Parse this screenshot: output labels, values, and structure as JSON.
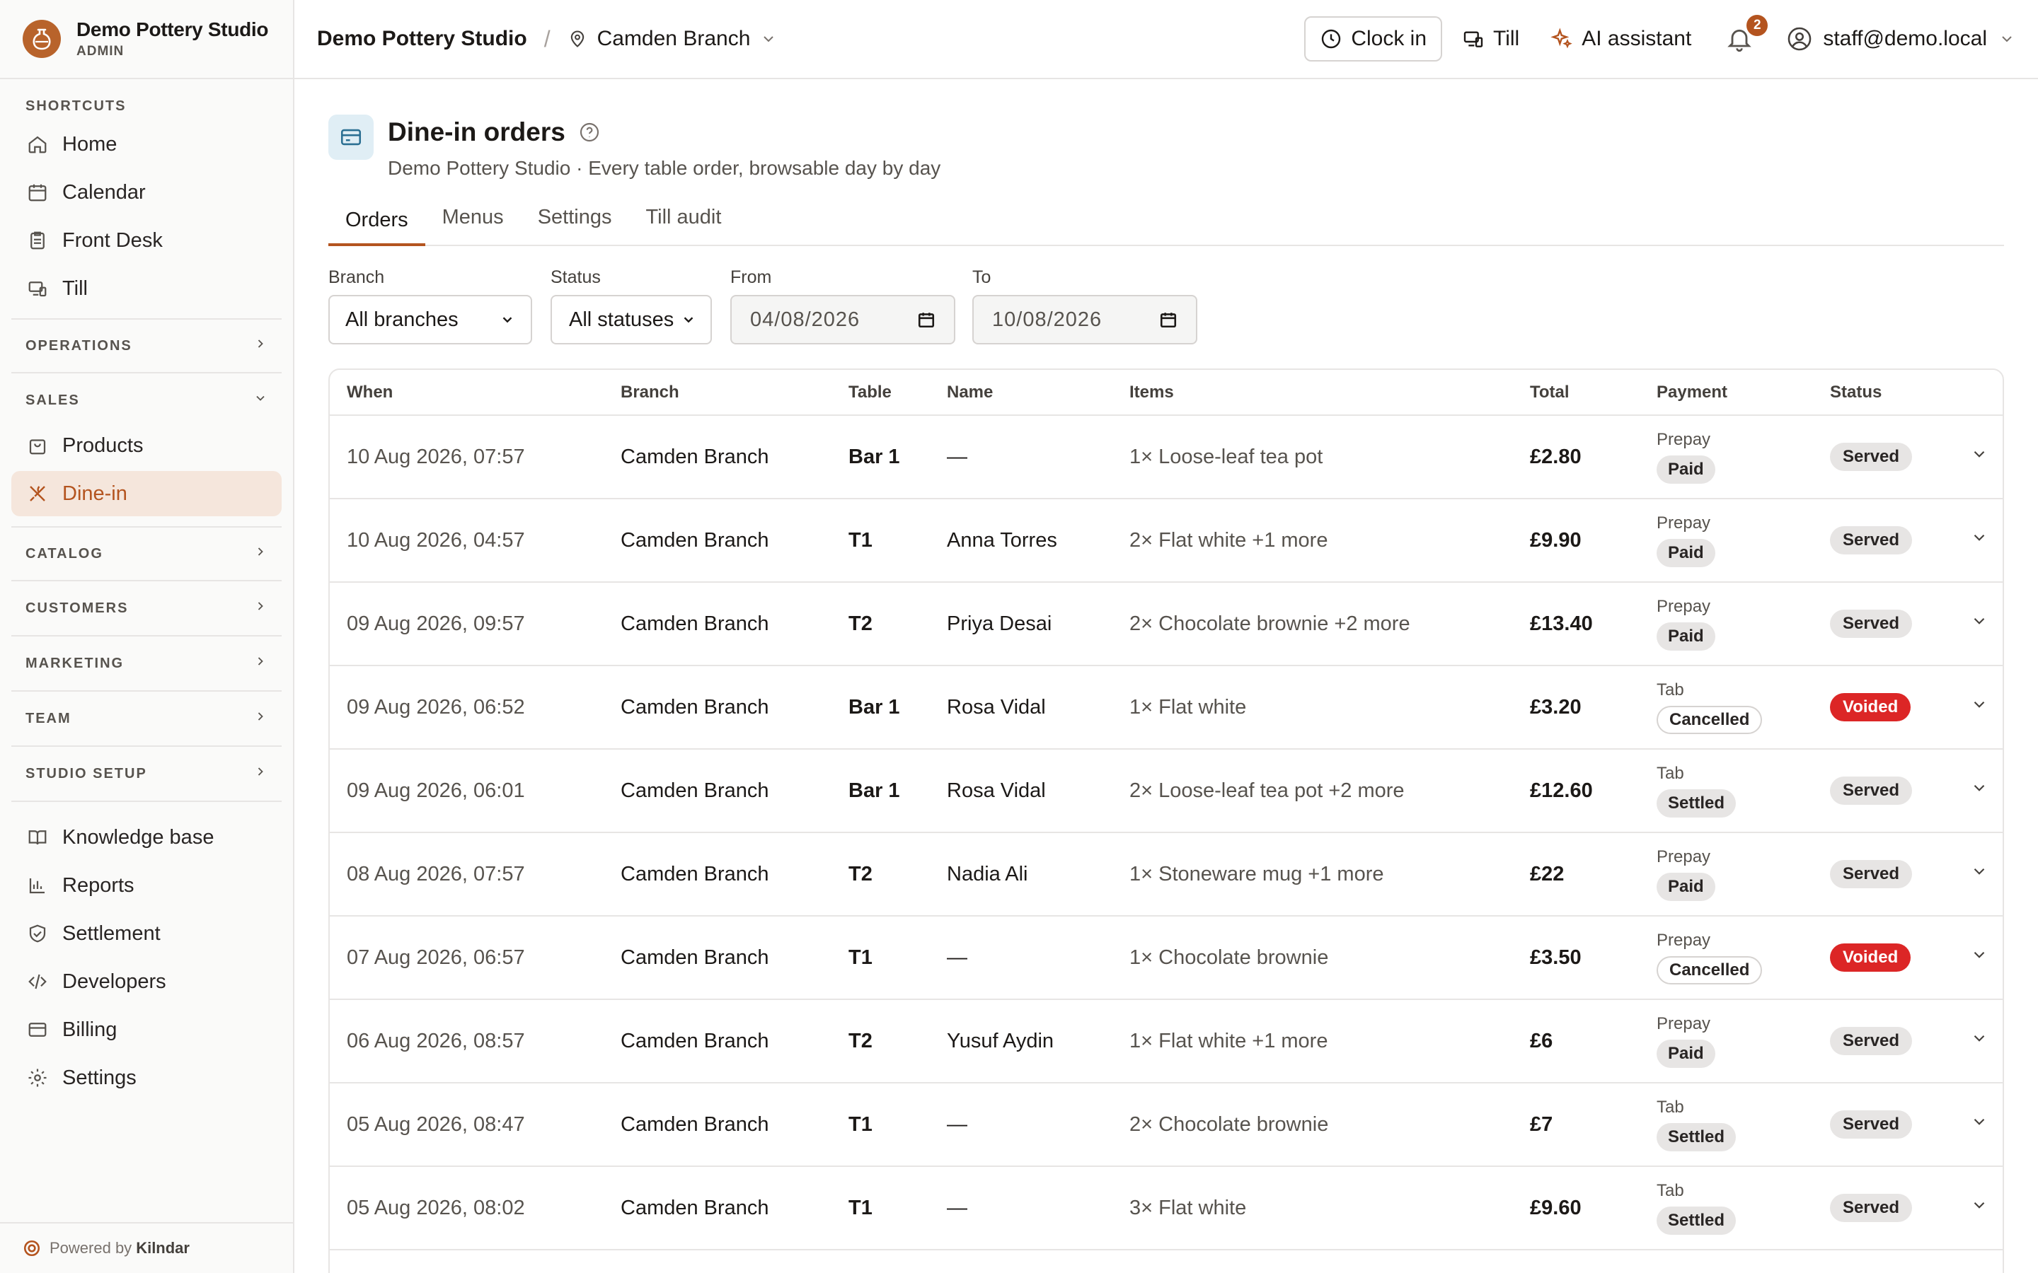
{
  "brand": {
    "name": "Demo Pottery Studio",
    "role": "ADMIN"
  },
  "sidebar": {
    "shortcuts_label": "SHORTCUTS",
    "shortcuts": [
      {
        "label": "Home",
        "icon": "home-icon"
      },
      {
        "label": "Calendar",
        "icon": "calendar-icon"
      },
      {
        "label": "Front Desk",
        "icon": "clipboard-icon"
      },
      {
        "label": "Till",
        "icon": "till-icon"
      }
    ],
    "operations_label": "OPERATIONS",
    "sales_label": "SALES",
    "sales": [
      {
        "label": "Products",
        "icon": "bag-icon"
      },
      {
        "label": "Dine-in",
        "icon": "utensils-icon"
      }
    ],
    "collapsed": [
      "CATALOG",
      "CUSTOMERS",
      "MARKETING",
      "TEAM",
      "STUDIO SETUP"
    ],
    "footer_items": [
      {
        "label": "Knowledge base",
        "icon": "book-icon"
      },
      {
        "label": "Reports",
        "icon": "chart-icon"
      },
      {
        "label": "Settlement",
        "icon": "badge-check-icon"
      },
      {
        "label": "Developers",
        "icon": "code-icon"
      },
      {
        "label": "Billing",
        "icon": "card-icon"
      },
      {
        "label": "Settings",
        "icon": "gear-icon"
      }
    ],
    "powered_by": "Powered by",
    "powered_brand": "Kilndar"
  },
  "topbar": {
    "studio": "Demo Pottery Studio",
    "separator": "/",
    "branch": "Camden Branch",
    "clock_in": "Clock in",
    "till": "Till",
    "ai": "AI assistant",
    "notifications": "2",
    "user": "staff@demo.local"
  },
  "page": {
    "title": "Dine-in orders",
    "subtitle": "Demo Pottery Studio · Every table order, browsable day by day",
    "tabs": [
      "Orders",
      "Menus",
      "Settings",
      "Till audit"
    ]
  },
  "filters": {
    "branch_label": "Branch",
    "branch_value": "All branches",
    "status_label": "Status",
    "status_value": "All statuses",
    "from_label": "From",
    "from_value": "04/08/2026",
    "to_label": "To",
    "to_value": "10/08/2026"
  },
  "table": {
    "headers": [
      "When",
      "Branch",
      "Table",
      "Name",
      "Items",
      "Total",
      "Payment",
      "Status"
    ],
    "rows": [
      {
        "when": "10 Aug 2026, 07:57",
        "branch": "Camden Branch",
        "table": "Bar 1",
        "name": "—",
        "items": "1× Loose-leaf tea pot",
        "total": "£2.80",
        "method": "Prepay",
        "payment": "Paid",
        "status": "Served"
      },
      {
        "when": "10 Aug 2026, 04:57",
        "branch": "Camden Branch",
        "table": "T1",
        "name": "Anna Torres",
        "items": "2× Flat white +1 more",
        "total": "£9.90",
        "method": "Prepay",
        "payment": "Paid",
        "status": "Served"
      },
      {
        "when": "09 Aug 2026, 09:57",
        "branch": "Camden Branch",
        "table": "T2",
        "name": "Priya Desai",
        "items": "2× Chocolate brownie +2 more",
        "total": "£13.40",
        "method": "Prepay",
        "payment": "Paid",
        "status": "Served"
      },
      {
        "when": "09 Aug 2026, 06:52",
        "branch": "Camden Branch",
        "table": "Bar 1",
        "name": "Rosa Vidal",
        "items": "1× Flat white",
        "total": "£3.20",
        "method": "Tab",
        "payment": "Cancelled",
        "status": "Voided"
      },
      {
        "when": "09 Aug 2026, 06:01",
        "branch": "Camden Branch",
        "table": "Bar 1",
        "name": "Rosa Vidal",
        "items": "2× Loose-leaf tea pot +2 more",
        "total": "£12.60",
        "method": "Tab",
        "payment": "Settled",
        "status": "Served"
      },
      {
        "when": "08 Aug 2026, 07:57",
        "branch": "Camden Branch",
        "table": "T2",
        "name": "Nadia Ali",
        "items": "1× Stoneware mug +1 more",
        "total": "£22",
        "method": "Prepay",
        "payment": "Paid",
        "status": "Served"
      },
      {
        "when": "07 Aug 2026, 06:57",
        "branch": "Camden Branch",
        "table": "T1",
        "name": "—",
        "items": "1× Chocolate brownie",
        "total": "£3.50",
        "method": "Prepay",
        "payment": "Cancelled",
        "status": "Voided"
      },
      {
        "when": "06 Aug 2026, 08:57",
        "branch": "Camden Branch",
        "table": "T2",
        "name": "Yusuf Aydin",
        "items": "1× Flat white +1 more",
        "total": "£6",
        "method": "Prepay",
        "payment": "Paid",
        "status": "Served"
      },
      {
        "when": "05 Aug 2026, 08:47",
        "branch": "Camden Branch",
        "table": "T1",
        "name": "—",
        "items": "2× Chocolate brownie",
        "total": "£7",
        "method": "Tab",
        "payment": "Settled",
        "status": "Served"
      },
      {
        "when": "05 Aug 2026, 08:02",
        "branch": "Camden Branch",
        "table": "T1",
        "name": "—",
        "items": "3× Flat white",
        "total": "£9.60",
        "method": "Tab",
        "payment": "Settled",
        "status": "Served"
      }
    ]
  },
  "colors": {
    "accent": "#b4541f",
    "voided": "#dc2626",
    "active_bg": "#f5e6dc"
  }
}
